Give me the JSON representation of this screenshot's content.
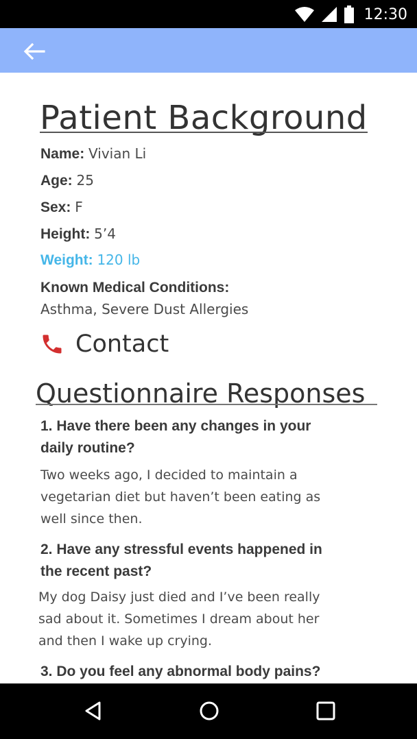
{
  "status_bar": {
    "time": "12:30",
    "icons": [
      "wifi-icon",
      "signal-icon",
      "battery-icon"
    ]
  },
  "app_bar": {
    "back_icon": "arrow-back-icon",
    "color": "#8fb4fb"
  },
  "patient": {
    "title": "Patient Background",
    "fields": [
      {
        "label": "Name:",
        "value": "Vivian Li"
      },
      {
        "label": "Age:",
        "value": "25"
      },
      {
        "label": "Sex:",
        "value": "F"
      },
      {
        "label": "Height:",
        "value": "5’4"
      },
      {
        "label": "Weight:",
        "value": "120 lb",
        "highlight_color": "#45b6e8"
      }
    ],
    "conditions_label": "Known Medical Conditions:",
    "conditions_value": "Asthma, Severe Dust Allergies",
    "contact_label": "Contact",
    "contact_icon": "phone-icon",
    "contact_icon_color": "#d32f2f"
  },
  "questionnaire": {
    "title": "Questionnaire Responses",
    "items": [
      {
        "question_line1": "1. Have there been any changes in your",
        "question_line2": "daily routine?",
        "answer_line1": "Two weeks ago, I decided to maintain a",
        "answer_line2": "vegetarian diet but haven’t been eating as",
        "answer_line3": "well since then."
      },
      {
        "question_line1": "2. Have any stressful events happened in",
        "question_line2": "the recent past?",
        "answer_line1": "My dog Daisy just died and I’ve been really",
        "answer_line2": "sad about it. Sometimes I dream about her",
        "answer_line3": "and then I wake up crying."
      },
      {
        "question_line1": "3. Do you feel any abnormal body pains?"
      }
    ]
  },
  "nav_bar": {
    "icons": [
      "nav-back-icon",
      "nav-home-icon",
      "nav-recents-icon"
    ]
  }
}
